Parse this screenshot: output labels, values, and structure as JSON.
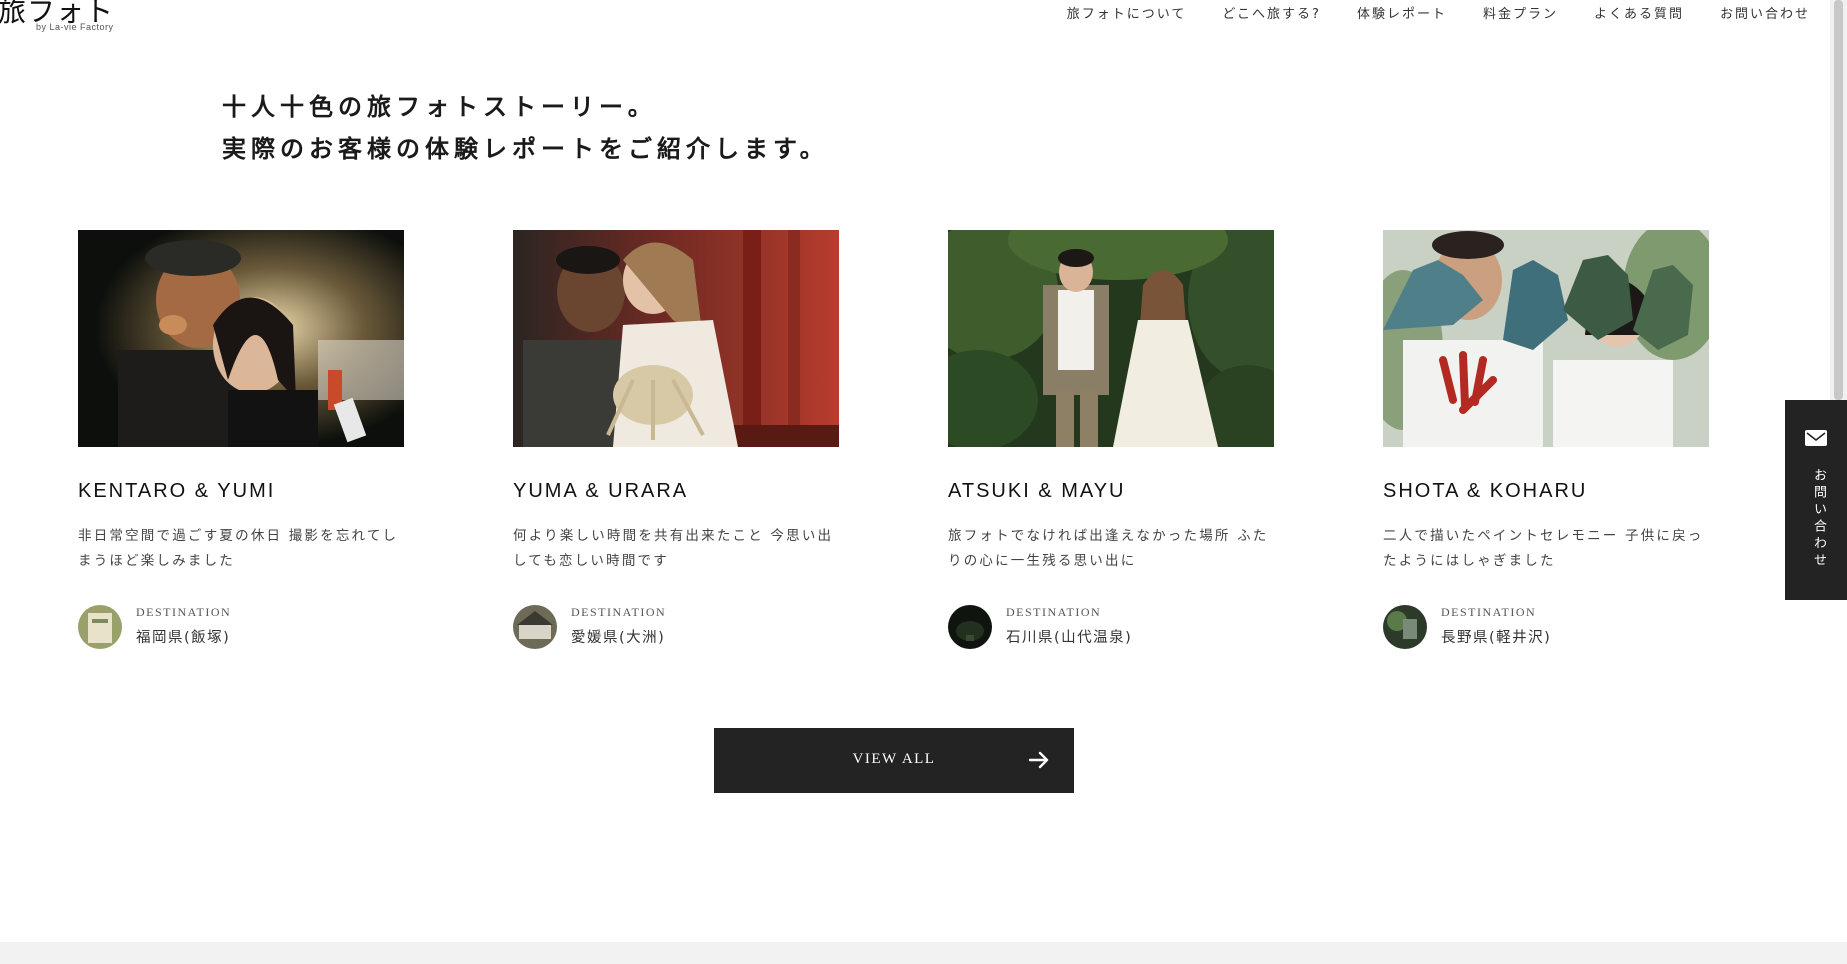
{
  "header": {
    "logo_mark": "旅フォト",
    "logo_sub": "by La-vie Factory",
    "nav": [
      {
        "label": "旅フォトについて"
      },
      {
        "label": "どこへ旅する?"
      },
      {
        "label": "体験レポート"
      },
      {
        "label": "料金プラン"
      },
      {
        "label": "よくある質問"
      },
      {
        "label": "お問い合わせ"
      }
    ]
  },
  "lead": {
    "line1": "十人十色の旅フォトストーリー。",
    "line2": "実際のお客様の体験レポートをご紹介します。"
  },
  "cards": [
    {
      "title": "KENTARO & YUMI",
      "text": "非日常空間で過ごす夏の休日 撮影を忘れてしまうほど楽しみました",
      "dest_label": "DESTINATION",
      "dest_place": "福岡県(飯塚)"
    },
    {
      "title": "YUMA & URARA",
      "text": "何より楽しい時間を共有出来たこと 今思い出しても恋しい時間です",
      "dest_label": "DESTINATION",
      "dest_place": "愛媛県(大洲)"
    },
    {
      "title": "ATSUKI & MAYU",
      "text": "旅フォトでなければ出逢えなかった場所 ふたりの心に一生残る思い出に",
      "dest_label": "DESTINATION",
      "dest_place": "石川県(山代温泉)"
    },
    {
      "title": "SHOTA & KOHARU",
      "text": "二人で描いたペイントセレモニー 子供に戻ったようにはしゃぎました",
      "dest_label": "DESTINATION",
      "dest_place": "長野県(軽井沢)"
    }
  ],
  "view_all": {
    "label": "VIEW ALL"
  },
  "side_contact": {
    "label": "お問い合わせ"
  },
  "colors": {
    "dark": "#232323",
    "text": "#222222",
    "background": "#ffffff"
  }
}
